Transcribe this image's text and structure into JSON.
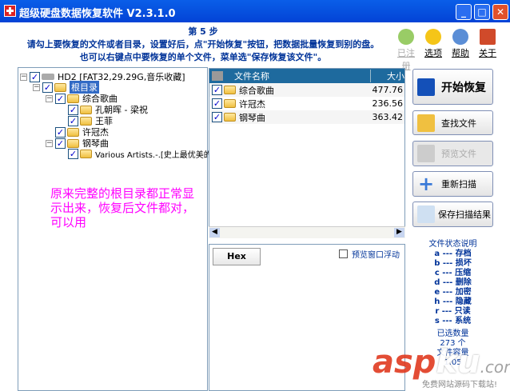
{
  "window": {
    "title": "超级硬盘数据恢复软件 V2.3.1.0",
    "min": "_",
    "max": "□",
    "close": "✕"
  },
  "header": {
    "step": "第 5 步",
    "line1": "请勾上要恢复的文件或者目录，设置好后，点\"开始恢复\"按钮，把数据批量恢复到别的盘。",
    "line2": "也可以右键点中要恢复的单个文件，菜单选\"保存恢复该文件\"。"
  },
  "toolbar": {
    "registered": "已注册",
    "options": "选项",
    "help": "帮助",
    "about": "关于"
  },
  "tree": {
    "drive": "HD2 [FAT32,29.29G,音乐收藏]",
    "root": "根目录",
    "n1": "综合歌曲",
    "n1a": "孔朝晖 - 梁祝",
    "n1b": "王菲",
    "n2": "许冠杰",
    "n3": "钢琴曲",
    "n3a": "Various Artists.-.[史上最优美的钢"
  },
  "annotation": "原来完整的根目录都正常显示出来，恢复后文件都对，可以用",
  "filelist": {
    "col_name": "文件名称",
    "col_size": "大小",
    "rows": [
      {
        "name": "综合歌曲",
        "size": "477.76"
      },
      {
        "name": "许冠杰",
        "size": "236.56"
      },
      {
        "name": "钢琴曲",
        "size": "363.42"
      }
    ]
  },
  "preview": {
    "tab": "Hex",
    "float_label": "预览窗口浮动"
  },
  "buttons": {
    "start": "开始恢复",
    "find": "查找文件",
    "preview": "预览文件",
    "rescan": "重新扫描",
    "save": "保存扫描结果"
  },
  "legend": {
    "title": "文件状态说明",
    "items": [
      "a --- 存档",
      "b --- 损坏",
      "c --- 压缩",
      "d --- 删除",
      "e --- 加密",
      "h --- 隐藏",
      "r --- 只读",
      "s --- 系统"
    ],
    "selected_label": "已选数量",
    "selected_value": "273 个",
    "capacity_label": "文件容量",
    "capacity_value": "1.05"
  },
  "watermark": {
    "logo": "aspku.com",
    "tagline": "免费网站源码下载站!"
  }
}
